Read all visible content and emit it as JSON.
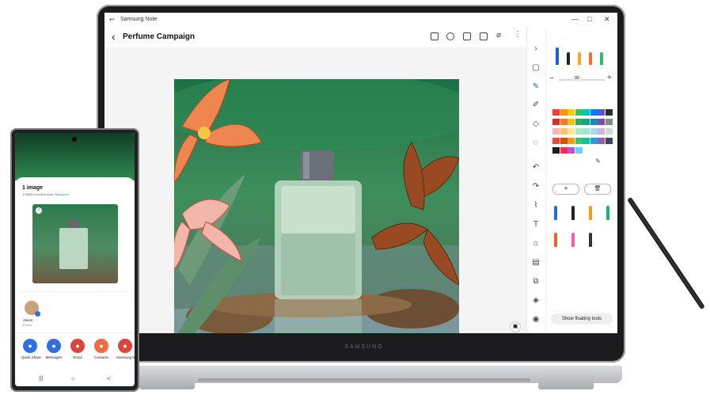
{
  "laptop": {
    "brand_text": "SAMSUNG",
    "window": {
      "app_title": "Samsung Note",
      "controls": [
        "—",
        "□",
        "✕"
      ]
    },
    "note": {
      "title": "Perfume Campaign"
    },
    "pen_panel": {
      "size_value": "30",
      "floating_tools_label": "Show floating tools",
      "palette": [
        "#ff3b30",
        "#ff9500",
        "#ffcc00",
        "#34c759",
        "#00c7be",
        "#007aff",
        "#5856d6",
        "#2c2c2e",
        "#c0392b",
        "#e67e22",
        "#f1c40f",
        "#27ae60",
        "#16a085",
        "#2980b9",
        "#8e44ad",
        "#7f8c8d",
        "#f5b7b1",
        "#f8c471",
        "#f9e79f",
        "#abebc6",
        "#a3e4d7",
        "#aed6f1",
        "#d2b4de",
        "#d5dbdb",
        "#e74c3c",
        "#d35400",
        "#f39c12",
        "#2ecc71",
        "#1abc9c",
        "#3498db",
        "#9b59b6",
        "#34495e",
        "#1c1c1e",
        "#ff2d55",
        "#af52de",
        "#64d2ff"
      ],
      "pen_colors": [
        "#1e5bd9",
        "#222222",
        "#f6a623",
        "#f27036",
        "#27c06a"
      ],
      "preset_colors": [
        "#1e6fe0",
        "#222222",
        "#f29b25",
        "#20b46a",
        "#e8622a",
        "#ff5aa8",
        "#333333"
      ]
    }
  },
  "phone": {
    "share_title": "1 image",
    "share_subtitle": "1.58MB",
    "share_location": "Location data",
    "share_location_link": "Remove it",
    "contact_name": "Alison",
    "contact_sub": "Phone",
    "apps": [
      {
        "label": "Quick Share",
        "color": "#2f6fe4",
        "icon": "quick-share-icon"
      },
      {
        "label": "Messages",
        "color": "#2f6fe4",
        "icon": "messages-icon"
      },
      {
        "label": "Email",
        "color": "#e0433c",
        "icon": "email-icon"
      },
      {
        "label": "Contacts",
        "color": "#f26b3a",
        "icon": "contacts-icon"
      },
      {
        "label": "Samsung Notes",
        "color": "#e0433c",
        "icon": "samsung-notes-icon"
      }
    ],
    "nav": [
      "|||",
      "○",
      "<"
    ]
  }
}
